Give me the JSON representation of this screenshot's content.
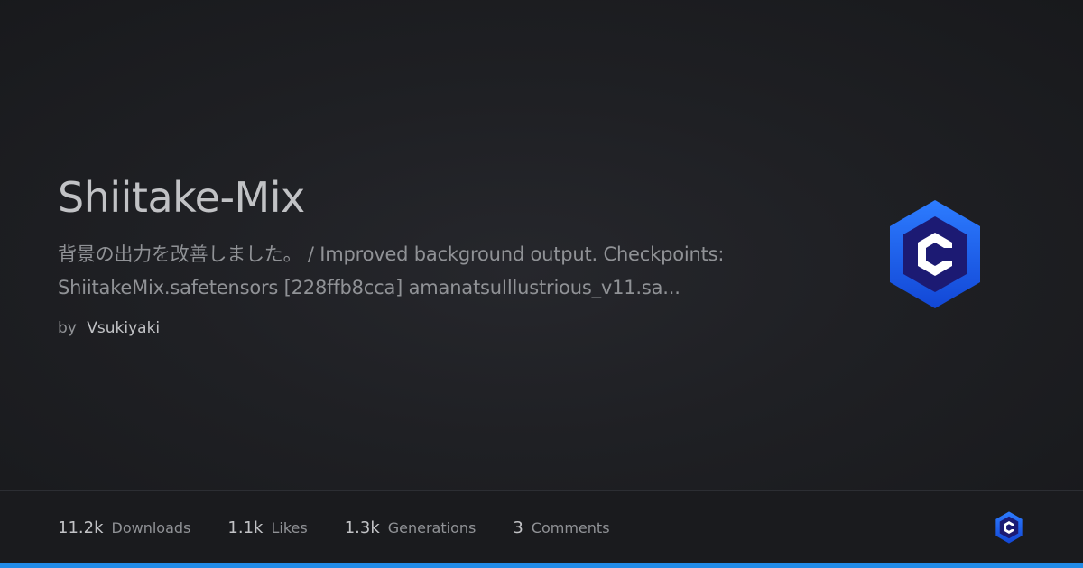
{
  "model": {
    "title": "Shiitake-Mix",
    "description_line1": "背景の出力を改善しました。 / Improved background output. Checkpoints:",
    "description_line2": "ShiitakeMix.safetensors [228ffb8cca] amanatsuIllustrious_v11.sa...",
    "by_label": "by",
    "author": "Vsukiyaki"
  },
  "stats": [
    {
      "value": "11.2k",
      "label": "Downloads"
    },
    {
      "value": "1.1k",
      "label": "Likes"
    },
    {
      "value": "1.3k",
      "label": "Generations"
    },
    {
      "value": "3",
      "label": "Comments"
    }
  ],
  "icons": {
    "hero_logo": "civitai-logo-icon",
    "footer_logo": "civitai-logo-icon"
  },
  "colors": {
    "background": "#1a1b1e",
    "title_text": "#c1c2c5",
    "muted_text": "#909296",
    "logo_outer": "#1e6fff",
    "logo_inner": "#1b1a7a",
    "accent_bar": "#228be6"
  }
}
